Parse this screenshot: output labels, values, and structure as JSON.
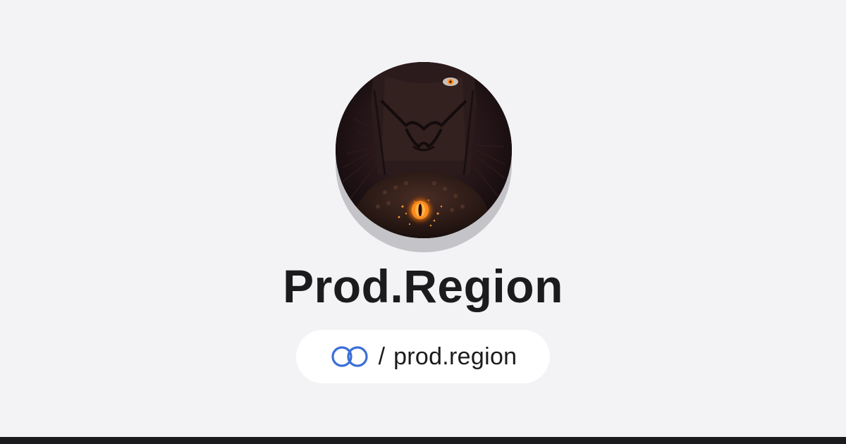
{
  "profile": {
    "display_name": "Prod.Region",
    "avatar_alt": "profile avatar"
  },
  "handle": {
    "separator": "/",
    "username": "prod.region"
  },
  "colors": {
    "background": "#f3f3f5",
    "text": "#1b1b1d",
    "accent_blue": "#3b6fd8",
    "bottom_bar": "#1b1b1d",
    "avatar_glow": "#ff8a1a"
  },
  "icons": {
    "logo": "linked-rings-icon"
  }
}
